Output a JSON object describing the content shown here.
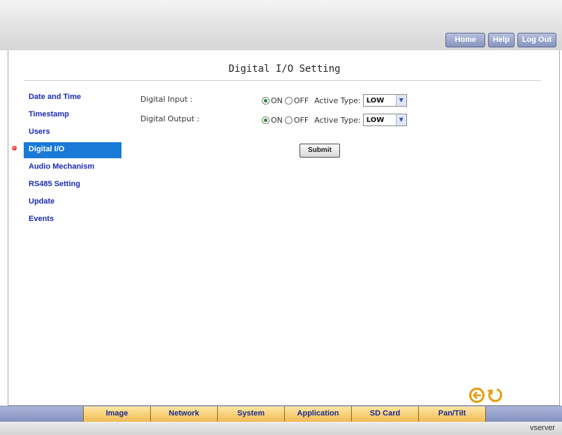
{
  "header": {
    "links": [
      "Home",
      "Help",
      "Log Out"
    ]
  },
  "page": {
    "title": "Digital I/O Setting"
  },
  "sidebar": {
    "items": [
      {
        "label": "Date and Time"
      },
      {
        "label": "Timestamp"
      },
      {
        "label": "Users"
      },
      {
        "label": "Digital I/O",
        "active": true
      },
      {
        "label": "Audio Mechanism"
      },
      {
        "label": "RS485 Setting"
      },
      {
        "label": "Update"
      },
      {
        "label": "Events"
      }
    ]
  },
  "form": {
    "digital_input": {
      "label": "Digital Input :",
      "on_label": "ON",
      "off_label": "OFF",
      "selected": "ON",
      "type_label": "Active Type:",
      "type_value": "LOW"
    },
    "digital_output": {
      "label": "Digital Output :",
      "on_label": "ON",
      "off_label": "OFF",
      "selected": "ON",
      "type_label": "Active Type:",
      "type_value": "LOW"
    },
    "submit_label": "Submit"
  },
  "nav_icons": [
    "back-arrow-icon",
    "refresh-icon"
  ],
  "tabs": [
    "Image",
    "Network",
    "System",
    "Application",
    "SD Card",
    "Pan/Tilt"
  ],
  "footer": {
    "brand": "vserver"
  },
  "colors": {
    "menu_link": "#1a2bb3",
    "menu_active_bg": "#1a7ad8",
    "tab_bg": "#f0bb55",
    "nav_icon": "#e89a10"
  }
}
